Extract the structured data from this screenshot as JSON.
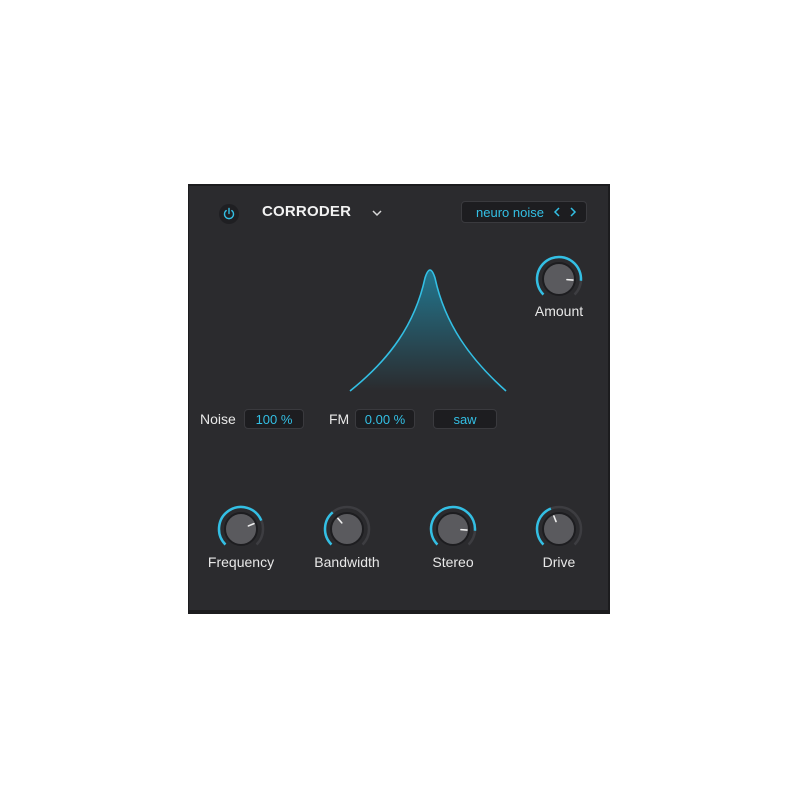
{
  "header": {
    "power_icon": "power-icon",
    "title": "CORRODER",
    "dropdown_icon": "chevron-down-icon",
    "preset": "neuro noise"
  },
  "params": {
    "noise_label": "Noise",
    "noise_value": "100 %",
    "fm_label": "FM",
    "fm_value": "0.00 %",
    "waveform_value": "saw"
  },
  "knobs": [
    {
      "label": "Amount",
      "value": 0.85
    },
    {
      "label": "Frequency",
      "value": 0.75
    },
    {
      "label": "Bandwidth",
      "value": 0.35
    },
    {
      "label": "Stereo",
      "value": 0.85
    },
    {
      "label": "Drive",
      "value": 0.42
    }
  ],
  "colors": {
    "accent": "#33bfe4",
    "panel": "#2b2b2e"
  }
}
